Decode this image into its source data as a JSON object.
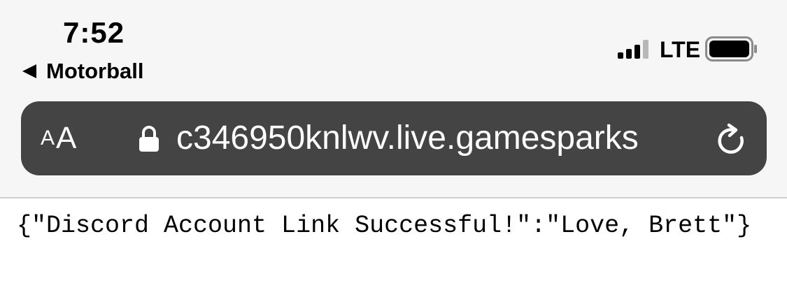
{
  "status_bar": {
    "time": "7:52",
    "back_app": "Motorball",
    "carrier": "LTE",
    "signal_icon": "cellular-signal-icon",
    "battery_icon": "battery-icon"
  },
  "address_bar": {
    "reader_label_small": "A",
    "reader_label_large": "A",
    "url": "c346950knlwv.live.gamesparks",
    "lock_icon": "lock-icon",
    "reload_icon": "reload-icon"
  },
  "page": {
    "body_text": "{\"Discord Account Link Successful!\":\"Love, Brett\"}"
  },
  "colors": {
    "chrome_bg": "#f6f6f6",
    "urlbar_bg": "#444444",
    "text": "#000000"
  }
}
